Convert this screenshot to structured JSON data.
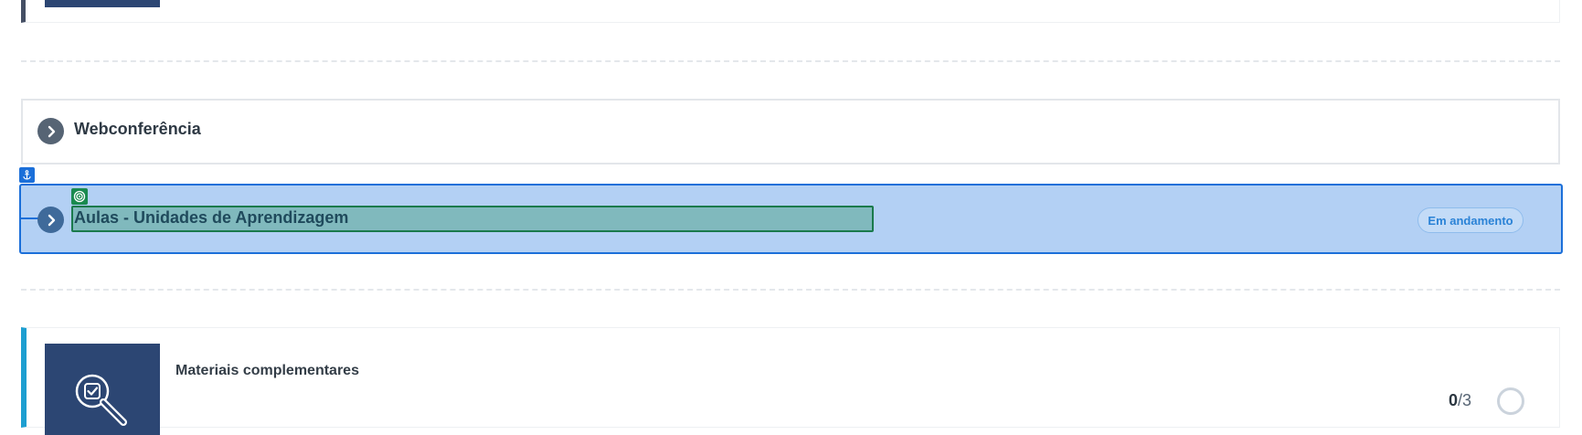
{
  "sections": [
    {
      "title": "Webconferência",
      "icon": "chevron-right-icon"
    },
    {
      "title": "Aulas - Unidades de Aprendizagem",
      "icon": "chevron-right-icon",
      "status": "Em andamento"
    }
  ],
  "selection": {
    "anchor_icon": "anchor-icon",
    "target_icon": "target-icon",
    "color": "#1b6fd9",
    "highlight_color": "#1a7a4c"
  },
  "card": {
    "title": "Materiais complementares",
    "progress_done": "0",
    "progress_total": "/3",
    "icon": "magnifier-check-icon",
    "accent": "#1d9fd1"
  }
}
